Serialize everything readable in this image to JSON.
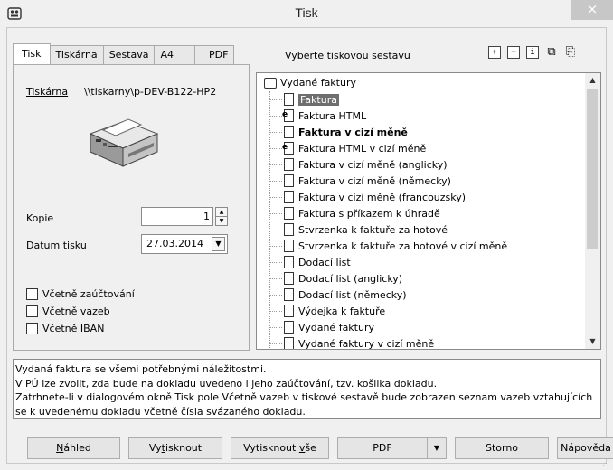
{
  "window": {
    "title": "Tisk",
    "close_icon": "×"
  },
  "tabs": [
    {
      "label": "Tisk",
      "active": true
    },
    {
      "label": "Tiskárna"
    },
    {
      "label": "Sestava"
    },
    {
      "label": "A4"
    },
    {
      "label": "PDF"
    }
  ],
  "left": {
    "printer_label": "Tiskárna",
    "printer_path": "\\\\tiskarny\\p-DEV-B122-HP2",
    "copies_label": "Kopie",
    "copies_value": "1",
    "date_label": "Datum tisku",
    "date_value": "27.03.2014",
    "checks": [
      {
        "label": "Včetně zaúčtování",
        "checked": false
      },
      {
        "label": "Včetně vazeb",
        "checked": false
      },
      {
        "label": "Včetně IBAN",
        "checked": false
      }
    ]
  },
  "right": {
    "caption": "Vyberte tiskovou sestavu",
    "toolbar": [
      "expand-icon",
      "collapse-icon",
      "info-icon",
      "copy-icon",
      "paste-icon"
    ],
    "tree_root": "Vydané faktury",
    "items": [
      {
        "label": "Faktura",
        "selected": true
      },
      {
        "label": "Faktura HTML",
        "html": true
      },
      {
        "label": "Faktura v cizí měně",
        "bold": true
      },
      {
        "label": "Faktura HTML v cizí měně",
        "html": true
      },
      {
        "label": "Faktura v cizí měně (anglicky)"
      },
      {
        "label": "Faktura v cizí měně (německy)"
      },
      {
        "label": "Faktura v cizí měně (francouzsky)"
      },
      {
        "label": "Faktura s příkazem k úhradě"
      },
      {
        "label": "Stvrzenka k faktuře za hotové"
      },
      {
        "label": "Stvrzenka k faktuře za hotové v cizí měně"
      },
      {
        "label": "Dodací list"
      },
      {
        "label": "Dodací list (anglicky)"
      },
      {
        "label": "Dodací list (německy)"
      },
      {
        "label": "Výdejka k faktuře"
      },
      {
        "label": "Vydané faktury"
      },
      {
        "label": "Vydané faktury v cizí měně"
      }
    ]
  },
  "description": [
    "Vydaná faktura se všemi potřebnými náležitostmi.",
    "V PÚ lze zvolit, zda bude na dokladu uvedeno i jeho zaúčtování, tzv. košilka dokladu.",
    "Zatrhnete-li v dialogovém okně Tisk pole Včetně vazeb v tiskové sestavě bude zobrazen seznam vazeb vztahujících",
    "se k uvedenému dokladu včetně čísla svázaného dokladu."
  ],
  "buttons": {
    "preview": {
      "pre": "",
      "u": "N",
      "post": "áhled"
    },
    "print": {
      "pre": "Vy",
      "u": "t",
      "post": "isknout"
    },
    "print_all": {
      "pre": "Vytisknout ",
      "u": "v",
      "post": "še"
    },
    "pdf": "PDF",
    "cancel": "Storno",
    "help": "Nápověda"
  }
}
